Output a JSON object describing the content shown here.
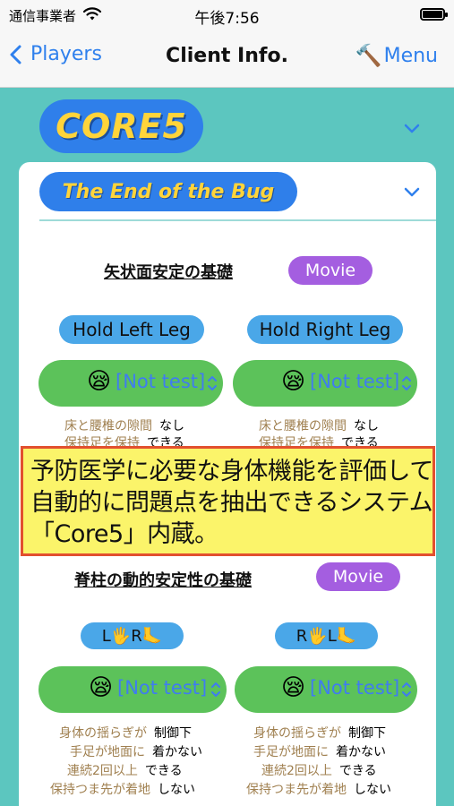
{
  "status_bar": {
    "carrier": "通信事業者",
    "time": "午後7:56"
  },
  "nav": {
    "back_label": "Players",
    "title": "Client Info.",
    "menu_label": "Menu"
  },
  "core_label": "CORE5",
  "sub_label": "The End of the Bug",
  "section1": {
    "title": "矢状面安定の基礎",
    "movie": "Movie",
    "left_label": "Hold Left Leg",
    "right_label": "Hold Right Leg",
    "left_select": {
      "emoji": "😪",
      "value": "[Not test]"
    },
    "right_select": {
      "emoji": "😪",
      "value": "[Not test]"
    },
    "left_results": [
      {
        "label": "床と腰椎の隙間",
        "value": "なし"
      },
      {
        "label": "保持足を保持",
        "value": "できる"
      }
    ],
    "right_results": [
      {
        "label": "床と腰椎の隙間",
        "value": "なし"
      },
      {
        "label": "保持足を保持",
        "value": "できる"
      }
    ]
  },
  "banner": {
    "lines": [
      "予防医学に必要な身体機能を評価して",
      "自動的に問題点を抽出できるシステム",
      "「Core5」内蔵。"
    ]
  },
  "section2": {
    "title": "脊柱の動的安定性の基礎",
    "movie": "Movie",
    "left_pill": {
      "a": "L",
      "hand": "🖐",
      "b": "R",
      "foot": "🦶"
    },
    "right_pill": {
      "a": "R",
      "hand": "🖐",
      "b": "L",
      "foot": "🦶"
    },
    "left_select": {
      "emoji": "😪",
      "value": "[Not test]"
    },
    "right_select": {
      "emoji": "😪",
      "value": "[Not test]"
    },
    "left_results": [
      {
        "label": "身体の揺らぎが",
        "value": "制御下"
      },
      {
        "label": "手足が地面に",
        "value": "着かない"
      },
      {
        "label": "連続2回以上",
        "value": "できる"
      },
      {
        "label": "保持つま先が着地",
        "value": "しない"
      }
    ],
    "right_results": [
      {
        "label": "身体の揺らぎが",
        "value": "制御下"
      },
      {
        "label": "手足が地面に",
        "value": "着かない"
      },
      {
        "label": "連続2回以上",
        "value": "できる"
      },
      {
        "label": "保持つま先が着地",
        "value": "しない"
      }
    ]
  },
  "colors": {
    "background": "#5cc6bf",
    "accent_blue": "#2f80ed",
    "pill_blue": "#2f7fea",
    "logo_yellow": "#ffd43a",
    "movie_purple": "#a45ee0",
    "select_green": "#5cc25a",
    "banner_yellow": "#fbf46a",
    "banner_border": "#e2502f"
  },
  "icons": {
    "wifi": "wifi-icon",
    "battery": "battery-icon",
    "back": "chevron-left-icon",
    "menu": "hammer-icon",
    "collapse": "chevron-down-icon",
    "select": "chevron-up-down-icon"
  }
}
